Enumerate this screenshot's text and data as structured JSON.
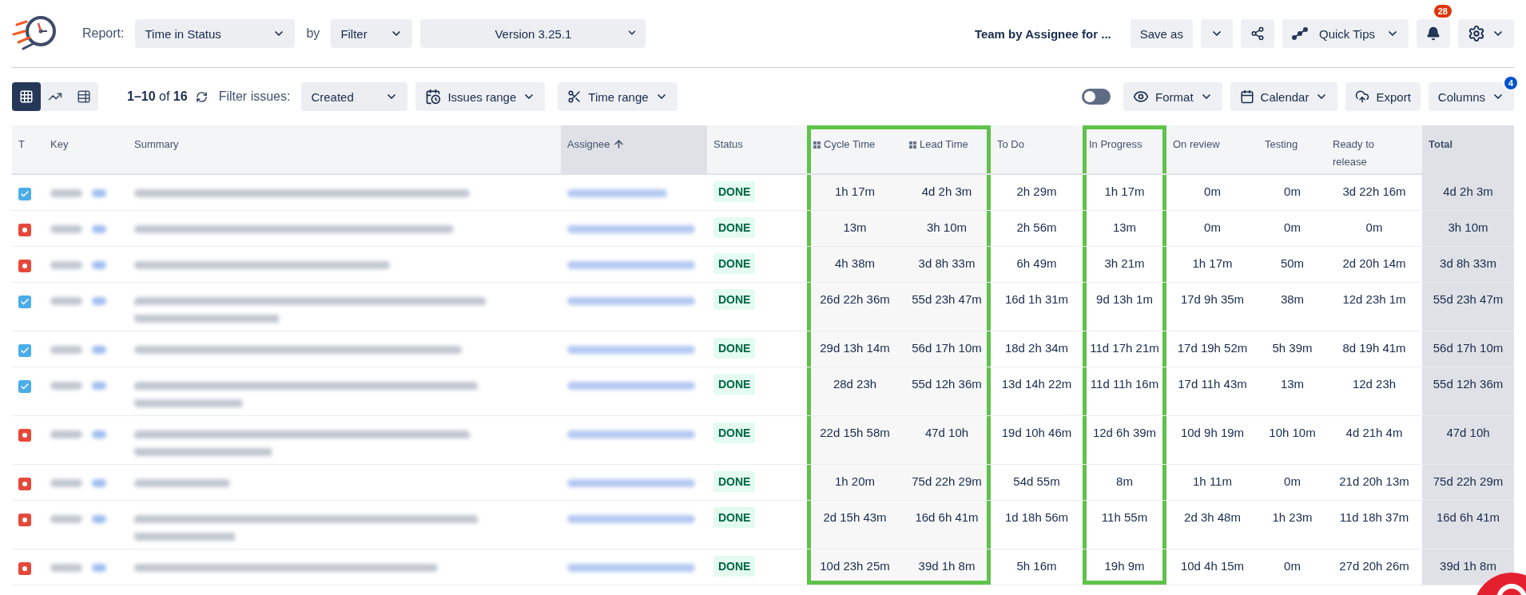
{
  "header": {
    "report_label": "Report:",
    "report": "Time in Status",
    "by_label": "by",
    "by": "Filter",
    "version": "Version 3.25.1",
    "preset": "Team by Assignee for ...",
    "save_as": "Save as",
    "quick_tips": "Quick Tips",
    "notifications": "28"
  },
  "toolbar": {
    "views": [
      {
        "kind": "grid",
        "selected": true
      },
      {
        "kind": "chart",
        "selected": false
      },
      {
        "kind": "pivot",
        "selected": false
      }
    ],
    "pager": "**1–10** of **16**",
    "filter_label": "Filter issues:",
    "filter": "Created",
    "issues_range": "Issues range",
    "time_range": "Time range",
    "toggle_on": false,
    "format": "Format",
    "calendar": "Calendar",
    "export": "Export",
    "columns": "Columns",
    "columns_count": "4"
  },
  "table": {
    "columns": [
      {
        "label": "T",
        "kind": "field",
        "outlined": false
      },
      {
        "label": "Key",
        "kind": "field",
        "outlined": false
      },
      {
        "label": "Summary",
        "kind": "field",
        "outlined": false
      },
      {
        "label": "Assignee",
        "kind": "sorted",
        "outlined": false
      },
      {
        "label": "Status",
        "kind": "field",
        "outlined": false
      },
      {
        "label": "Cycle Time",
        "kind": "metric",
        "outlined": true
      },
      {
        "label": "Lead Time",
        "kind": "metric",
        "outlined": true
      },
      {
        "label": "To Do",
        "kind": "status",
        "outlined": false
      },
      {
        "label": "In Progress",
        "kind": "status",
        "outlined": true
      },
      {
        "label": "On review",
        "kind": "status",
        "outlined": false
      },
      {
        "label": "Testing",
        "kind": "status",
        "outlined": false
      },
      {
        "label": "Ready to release",
        "kind": "status",
        "outlined": false
      },
      {
        "label": "Total",
        "kind": "total",
        "outlined": false
      }
    ],
    "rows": [
      {
        "kind": "task",
        "wrapped": false,
        "status": "DONE",
        "times": [
          "1h 17m",
          "4d 2h 3m",
          "2h 29m",
          "1h 17m",
          "0m",
          "0m",
          "3d 22h 16m",
          "4d 2h 3m"
        ]
      },
      {
        "kind": "bug",
        "wrapped": false,
        "status": "DONE",
        "times": [
          "13m",
          "3h 10m",
          "2h 56m",
          "13m",
          "0m",
          "0m",
          "0m",
          "3h 10m"
        ]
      },
      {
        "kind": "bug",
        "wrapped": false,
        "status": "DONE",
        "times": [
          "4h 38m",
          "3d 8h 33m",
          "6h 49m",
          "3h 21m",
          "1h 17m",
          "50m",
          "2d 20h 14m",
          "3d 8h 33m"
        ]
      },
      {
        "kind": "task",
        "wrapped": true,
        "status": "DONE",
        "times": [
          "26d 22h 36m",
          "55d 23h 47m",
          "16d 1h 31m",
          "9d 13h 1m",
          "17d 9h 35m",
          "38m",
          "12d 23h 1m",
          "55d 23h 47m"
        ]
      },
      {
        "kind": "task",
        "wrapped": false,
        "status": "DONE",
        "times": [
          "29d 13h 14m",
          "56d 17h 10m",
          "18d 2h 34m",
          "11d 17h 21m",
          "17d 19h 52m",
          "5h 39m",
          "8d 19h 41m",
          "56d 17h 10m"
        ]
      },
      {
        "kind": "task",
        "wrapped": true,
        "status": "DONE",
        "times": [
          "28d 23h",
          "55d 12h 36m",
          "13d 14h 22m",
          "11d 11h 16m",
          "17d 11h 43m",
          "13m",
          "12d 23h",
          "55d 12h 36m"
        ]
      },
      {
        "kind": "bug",
        "wrapped": true,
        "status": "DONE",
        "times": [
          "22d 15h 58m",
          "47d 10h",
          "19d 10h 46m",
          "12d 6h 39m",
          "10d 9h 19m",
          "10h 10m",
          "4d 21h 4m",
          "47d 10h"
        ]
      },
      {
        "kind": "bug",
        "wrapped": false,
        "status": "DONE",
        "times": [
          "1h 20m",
          "75d 22h 29m",
          "54d 55m",
          "8m",
          "1h 11m",
          "0m",
          "21d 20h 13m",
          "75d 22h 29m"
        ]
      },
      {
        "kind": "bug",
        "wrapped": true,
        "status": "DONE",
        "times": [
          "2d 15h 43m",
          "16d 6h 41m",
          "1d 18h 56m",
          "11h 55m",
          "2d 3h 48m",
          "1h 23m",
          "11d 18h 37m",
          "16d 6h 41m"
        ]
      },
      {
        "kind": "bug",
        "wrapped": false,
        "status": "DONE",
        "times": [
          "10d 23h 25m",
          "39d 1h 8m",
          "5h 16m",
          "19h 9m",
          "10d 4h 15m",
          "0m",
          "27d 20h 26m",
          "39d 1h 8m"
        ]
      }
    ]
  }
}
